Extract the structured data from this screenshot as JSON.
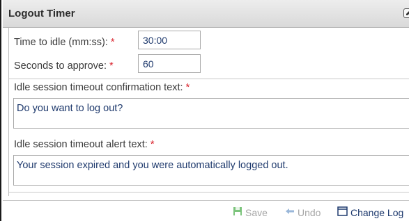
{
  "panel": {
    "title": "Logout Timer",
    "header_icon": "edit-icon"
  },
  "form": {
    "idle_time": {
      "label": "Time to idle (mm:ss):",
      "required_mark": "*",
      "value": "30:00"
    },
    "approve_seconds": {
      "label": "Seconds to approve:",
      "required_mark": "*",
      "value": "60"
    },
    "confirmation_text": {
      "label": "Idle session timeout confirmation text:",
      "required_mark": "*",
      "value": "Do you want to log out?"
    },
    "alert_text": {
      "label": "Idle session timeout alert text:",
      "required_mark": "*",
      "value": "Your session expired and you were automatically logged out."
    }
  },
  "footer": {
    "save_label": "Save",
    "undo_label": "Undo",
    "changelog_label": "Change Log",
    "save_icon": "save-icon",
    "undo_icon": "undo-arrow-icon",
    "changelog_icon": "window-icon"
  },
  "colors": {
    "required": "#d9232d",
    "value_text": "#1f3a6d",
    "disabled": "#a6a6a6",
    "accent": "#1e3a6e",
    "save_icon_green": "#5cb85c"
  }
}
